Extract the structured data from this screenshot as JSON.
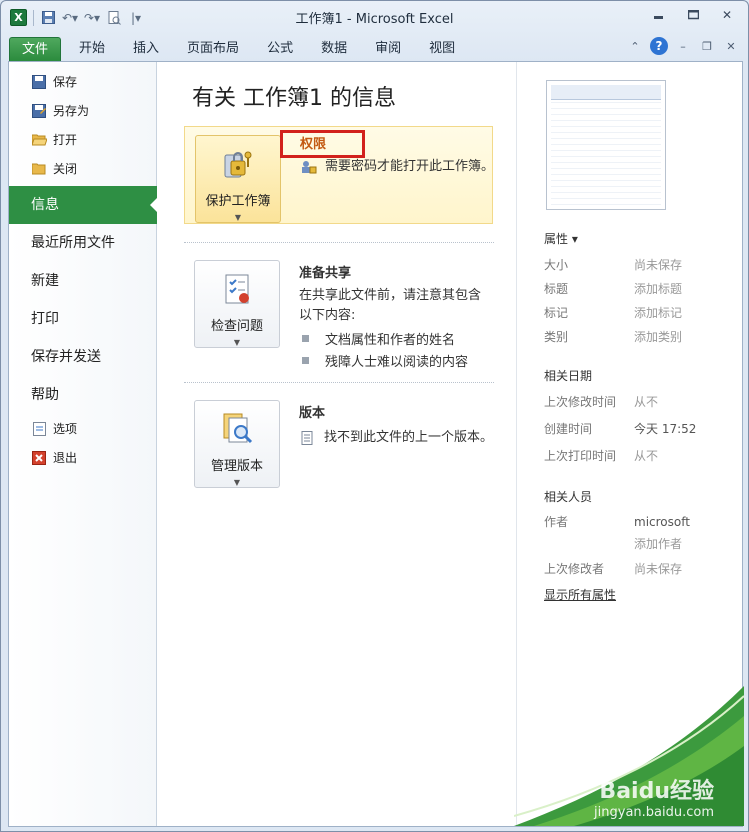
{
  "window": {
    "title": "工作簿1 - Microsoft Excel",
    "app_icon": "X"
  },
  "ribbon": {
    "tabs": [
      "文件",
      "开始",
      "插入",
      "页面布局",
      "公式",
      "数据",
      "审阅",
      "视图"
    ],
    "help_glyph": "?"
  },
  "nav": {
    "small_top": [
      {
        "label": "保存",
        "icon": "save-icon"
      },
      {
        "label": "另存为",
        "icon": "save-as-icon"
      },
      {
        "label": "打开",
        "icon": "open-folder-icon"
      },
      {
        "label": "关闭",
        "icon": "close-folder-icon"
      }
    ],
    "big": [
      {
        "label": "信息",
        "active": true
      },
      {
        "label": "最近所用文件"
      },
      {
        "label": "新建"
      },
      {
        "label": "打印"
      },
      {
        "label": "保存并发送"
      },
      {
        "label": "帮助"
      }
    ],
    "small_bottom": [
      {
        "label": "选项",
        "icon": "options-icon"
      },
      {
        "label": "退出",
        "icon": "exit-icon"
      }
    ]
  },
  "main": {
    "title": "有关 工作簿1 的信息",
    "permissions": {
      "button": "保护工作簿",
      "title": "权限",
      "desc": "需要密码才能打开此工作簿。"
    },
    "prepare": {
      "button": "检查问题",
      "title": "准备共享",
      "desc": "在共享此文件前，请注意其包含以下内容:",
      "bullets": [
        "文档属性和作者的姓名",
        "残障人士难以阅读的内容"
      ]
    },
    "versions": {
      "button": "管理版本",
      "title": "版本",
      "desc": "找不到此文件的上一个版本。"
    }
  },
  "properties": {
    "header": "属性 ▾",
    "rows": [
      {
        "k": "大小",
        "v": "尚未保存"
      },
      {
        "k": "标题",
        "v": "添加标题"
      },
      {
        "k": "标记",
        "v": "添加标记"
      },
      {
        "k": "类别",
        "v": "添加类别"
      }
    ],
    "dates_header": "相关日期",
    "dates": [
      {
        "k": "上次修改时间",
        "v": "从不"
      },
      {
        "k": "创建时间",
        "v": "今天 17:52"
      },
      {
        "k": "上次打印时间",
        "v": "从不"
      }
    ],
    "people_header": "相关人员",
    "author_label": "作者",
    "author_value": "microsoft",
    "add_author": "添加作者",
    "last_modified_by_label": "上次修改者",
    "last_modified_by_value": "尚未保存",
    "show_all": "显示所有属性"
  },
  "watermark": {
    "line1": "Baidu经验",
    "line2": "jingyan.baidu.com"
  }
}
